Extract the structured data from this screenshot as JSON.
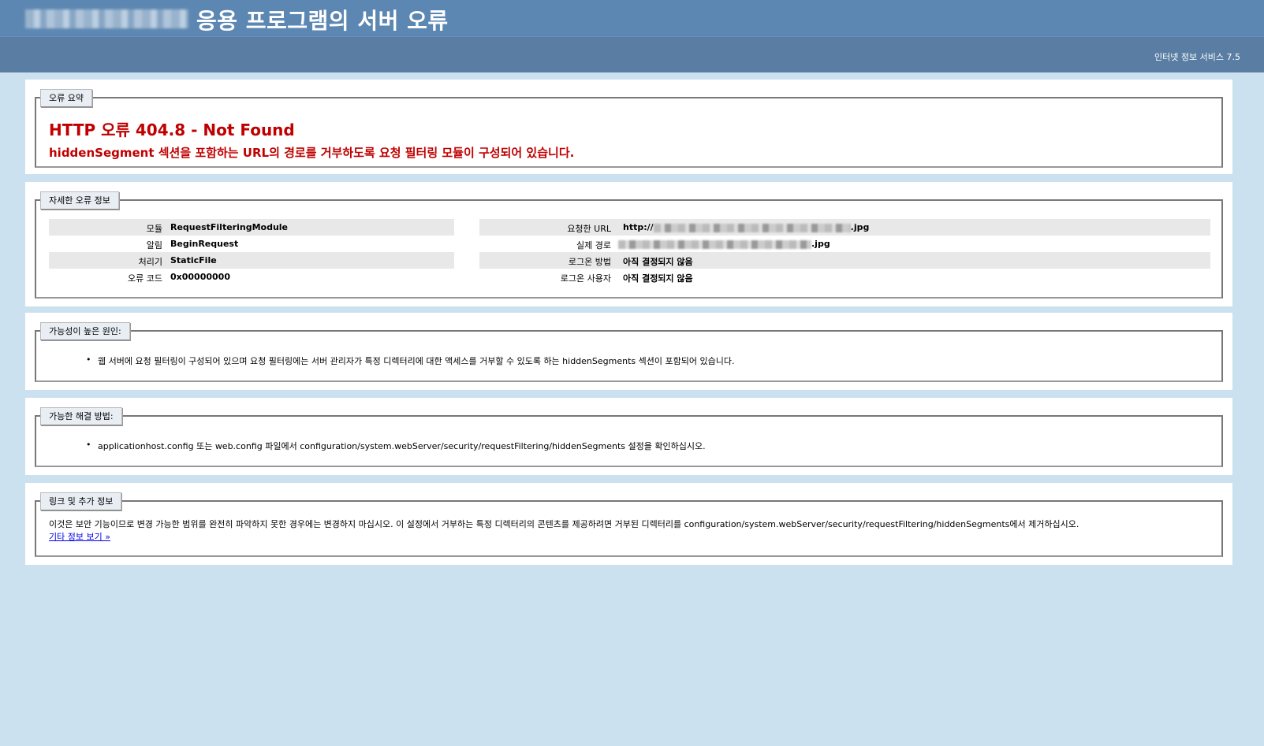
{
  "header": {
    "title": "응용 프로그램의 서버 오류",
    "product": "인터넷 정보 서비스 7.5"
  },
  "summary": {
    "legend": "오류 요약",
    "title": "HTTP 오류 404.8 - Not Found",
    "description": "hiddenSegment 섹션을 포함하는 URL의 경로를 거부하도록 요청 필터링 모듈이 구성되어 있습니다."
  },
  "details": {
    "legend": "자세한 오류 정보",
    "left": [
      {
        "label": "모듈",
        "value": "RequestFilteringModule"
      },
      {
        "label": "알림",
        "value": "BeginRequest"
      },
      {
        "label": "처리기",
        "value": "StaticFile"
      },
      {
        "label": "오류 코드",
        "value": "0x00000000"
      }
    ],
    "right": [
      {
        "label": "요청한 URL",
        "value_prefix": "http://",
        "value_suffix": ".jpg"
      },
      {
        "label": "실제 경로",
        "value_prefix": "",
        "value_suffix": ".jpg"
      },
      {
        "label": "로그온 방법",
        "value": "아직 결정되지 않음"
      },
      {
        "label": "로그온 사용자",
        "value": "아직 결정되지 않음"
      }
    ]
  },
  "causes": {
    "legend": "가능성이 높은 원인:",
    "items": [
      "웹 서버에 요청 필터링이 구성되어 있으며 요청 필터링에는 서버 관리자가 특정 디렉터리에 대한 액세스를 거부할 수 있도록 하는 hiddenSegments 섹션이 포함되어 있습니다."
    ]
  },
  "solutions": {
    "legend": "가능한 해결 방법:",
    "items": [
      "applicationhost.config 또는 web.config 파일에서 configuration/system.webServer/security/requestFiltering/hiddenSegments 설정을 확인하십시오."
    ]
  },
  "links": {
    "legend": "링크 및 추가 정보",
    "text": "이것은 보안 기능이므로 변경 가능한 범위를 완전히 파악하지 못한 경우에는 변경하지 마십시오. 이 설정에서 거부하는 특정 디렉터리의 콘텐츠를 제공하려면 거부된 디렉터리를 configuration/system.webServer/security/requestFiltering/hiddenSegments에서 제거하십시오.",
    "more": "기타 정보 보기 »"
  }
}
